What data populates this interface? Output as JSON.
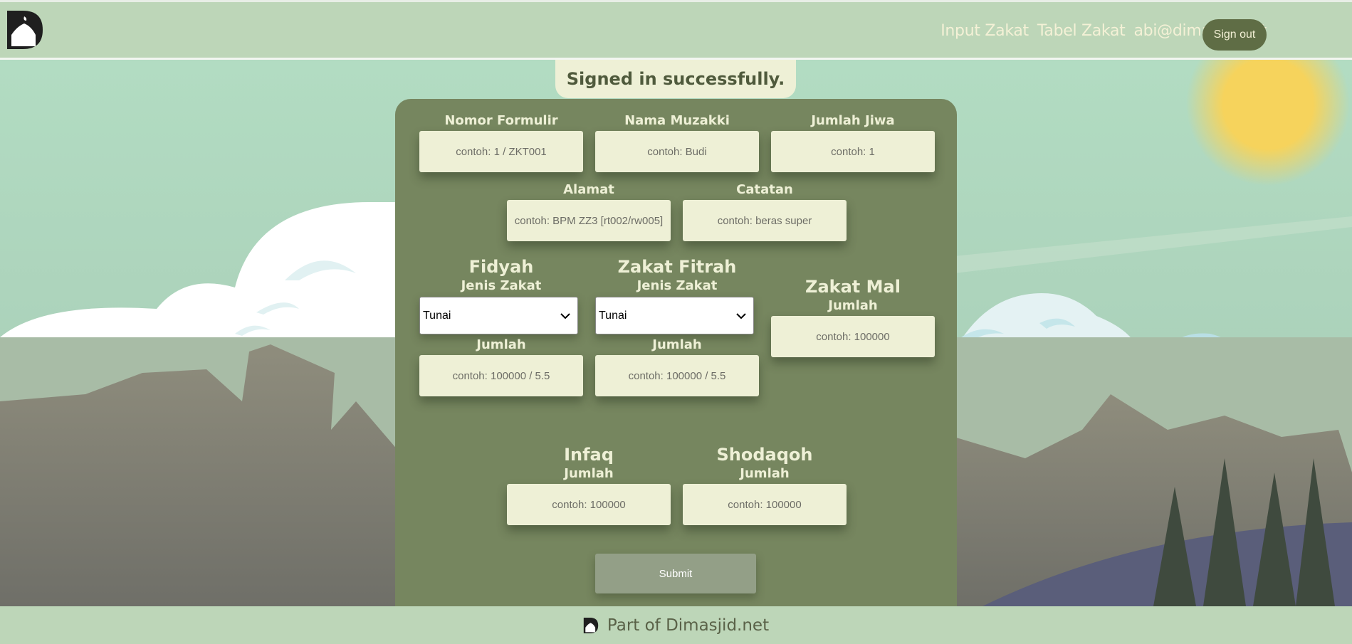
{
  "header": {
    "nav": [
      "Input Zakat",
      "Tabel Zakat",
      "abi@dimasjid.net"
    ],
    "signout_label": "Sign out"
  },
  "flash": "Signed in successfully.",
  "form": {
    "nomor_label": "Nomor Formulir",
    "nomor_placeholder": "contoh: 1 / ZKT001",
    "nama_label": "Nama Muzakki",
    "nama_placeholder": "contoh: Budi",
    "jiwa_label": "Jumlah Jiwa",
    "jiwa_placeholder": "contoh: 1",
    "alamat_label": "Alamat",
    "alamat_placeholder": "contoh: BPM ZZ3 [rt002/rw005]",
    "catatan_label": "Catatan",
    "catatan_placeholder": "contoh: beras super",
    "fidyah": {
      "title": "Fidyah",
      "jenis_label": "Jenis Zakat",
      "jenis_value": "Tunai",
      "jumlah_label": "Jumlah",
      "jumlah_placeholder": "contoh: 100000 / 5.5"
    },
    "fitrah": {
      "title": "Zakat Fitrah",
      "jenis_label": "Jenis Zakat",
      "jenis_value": "Tunai",
      "jumlah_label": "Jumlah",
      "jumlah_placeholder": "contoh: 100000 / 5.5"
    },
    "mal": {
      "title": "Zakat Mal",
      "jumlah_label": "Jumlah",
      "jumlah_placeholder": "contoh: 100000"
    },
    "infaq": {
      "title": "Infaq",
      "jumlah_label": "Jumlah",
      "jumlah_placeholder": "contoh: 100000"
    },
    "shodaqoh": {
      "title": "Shodaqoh",
      "jumlah_label": "Jumlah",
      "jumlah_placeholder": "contoh: 100000"
    },
    "submit_label": "Submit"
  },
  "footer": {
    "text": "Part of Dimasjid.net"
  },
  "colors": {
    "header_bg": "#bdd6b8",
    "card_bg": "#76865f",
    "field_bg": "#eef0d6",
    "accent": "#5f6d45"
  }
}
